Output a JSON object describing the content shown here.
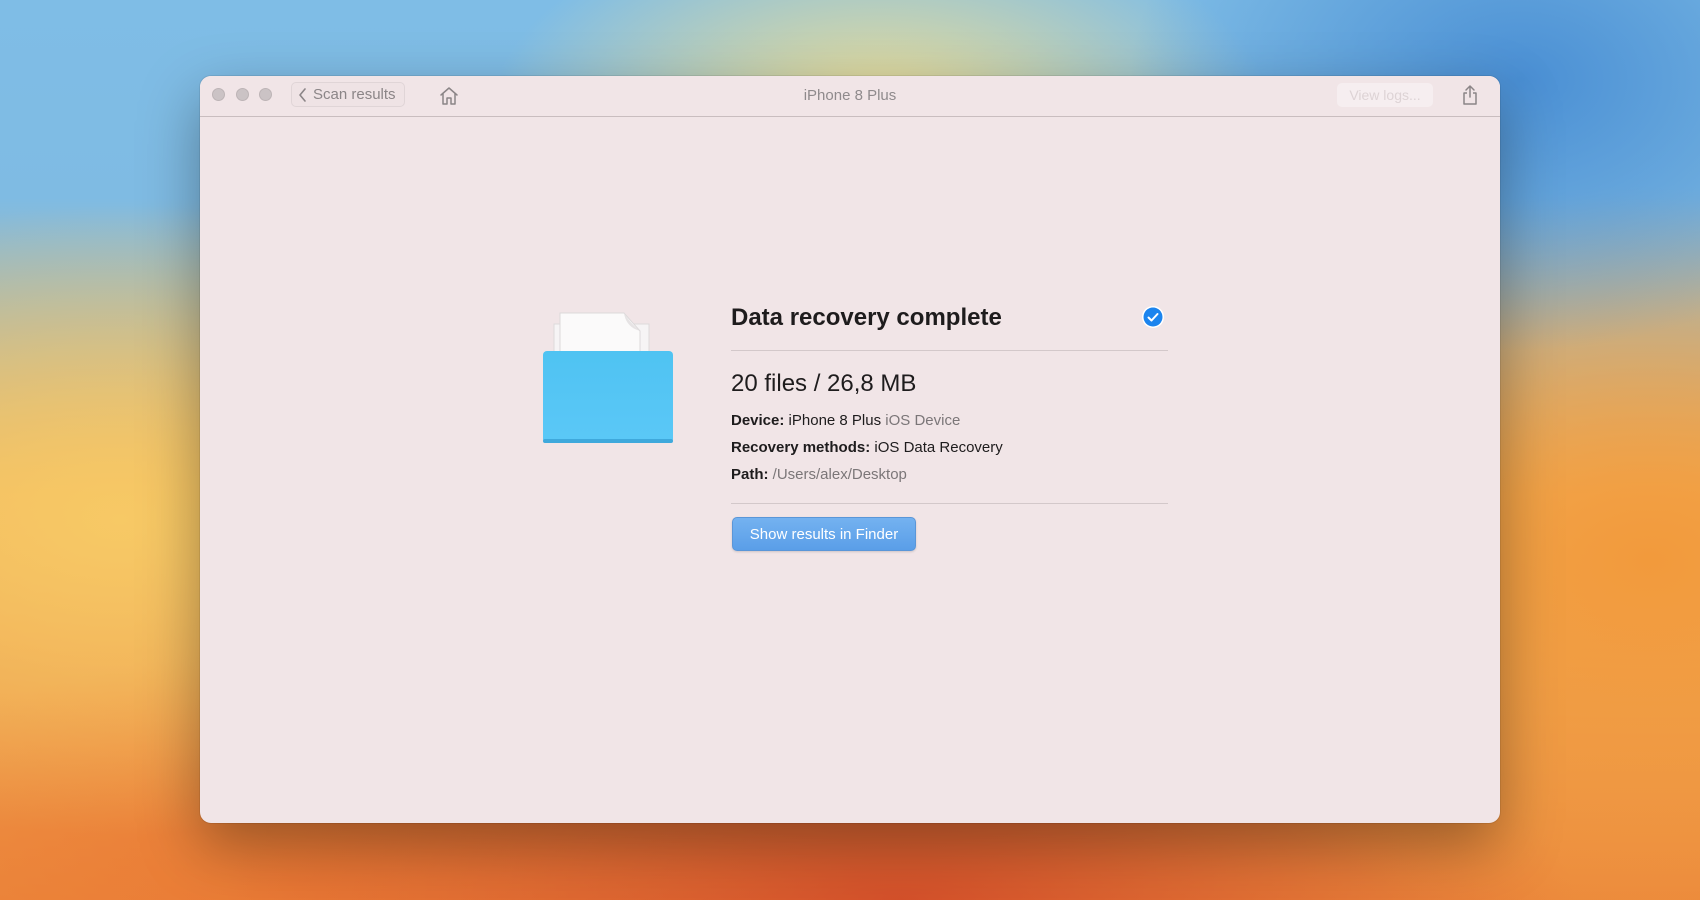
{
  "window": {
    "title": "iPhone 8 Plus",
    "back_button_label": "Scan results",
    "view_logs_label": "View logs...",
    "traffic_lights": [
      "close",
      "minimize",
      "zoom"
    ]
  },
  "result": {
    "title": "Data recovery complete",
    "status_icon": "checkmark-circle-icon",
    "summary": "20 files / 26,8 MB",
    "device_label": "Device:",
    "device_value": "iPhone 8 Plus",
    "device_type": "iOS Device",
    "methods_label": "Recovery methods:",
    "methods_value": "iOS Data Recovery",
    "path_label": "Path:",
    "path_value": "/Users/alex/Desktop",
    "show_button_label": "Show results in Finder"
  },
  "colors": {
    "accent": "#5a9ee8",
    "check": "#1c84ee",
    "window_bg": "#f1e5e7"
  }
}
